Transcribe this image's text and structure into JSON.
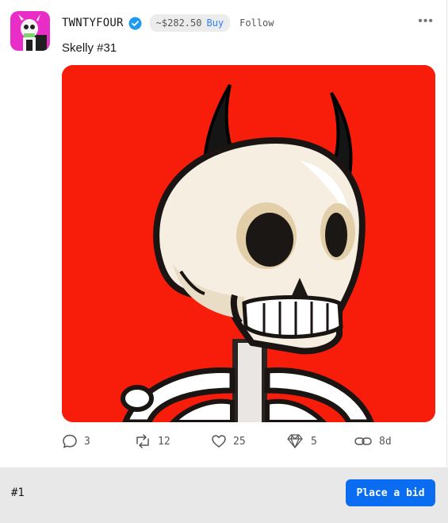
{
  "post": {
    "username": "TWNTYFOUR",
    "verified_icon": "verified-check-icon",
    "price": "~$282.50",
    "buy_label": "Buy",
    "follow_label": "Follow",
    "more_icon": "more-horizontal-icon",
    "more_label": "•••",
    "text": "Skelly #31",
    "image_alt": "Skull with devil horns on red background"
  },
  "actions": {
    "replies": {
      "icon": "comment-icon",
      "count": "3"
    },
    "reposts": {
      "icon": "repost-icon",
      "count": "12"
    },
    "likes": {
      "icon": "heart-icon",
      "count": "25"
    },
    "gems": {
      "icon": "diamond-icon",
      "count": "5"
    },
    "link": {
      "icon": "link-icon",
      "label": "8d"
    }
  },
  "footer": {
    "rank": "#1",
    "bid_label": "Place a bid"
  },
  "colors": {
    "accent": "#2d7ff9",
    "bid_button": "#0a6cf1",
    "image_bg": "#f81d0a",
    "avatar_bg": "#e92ec8"
  }
}
